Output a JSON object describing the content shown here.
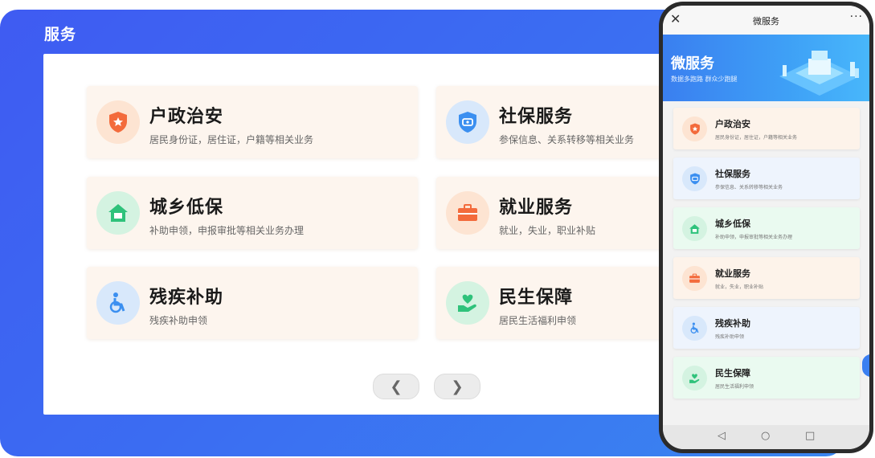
{
  "desktop": {
    "title": "服务",
    "cards": [
      {
        "title": "户政治安",
        "desc": "居民身份证，居住证，户籍等相关业务",
        "icon": "police-badge-icon",
        "color": "#f36b3c",
        "bg": "#fde4d2"
      },
      {
        "title": "社保服务",
        "desc": "参保信息、关系转移等相关业务",
        "icon": "social-security-icon",
        "color": "#3b8ff0",
        "bg": "#d8e8fb"
      },
      {
        "title": "城乡低保",
        "desc": "补助申领，申报审批等相关业务办理",
        "icon": "low-income-house-icon",
        "color": "#2fc27b",
        "bg": "#d4f3e1"
      },
      {
        "title": "就业服务",
        "desc": "就业，失业，职业补贴",
        "icon": "briefcase-icon",
        "color": "#f36b3c",
        "bg": "#fde4d2"
      },
      {
        "title": "残疾补助",
        "desc": "残疾补助申领",
        "icon": "wheelchair-icon",
        "color": "#3b8ff0",
        "bg": "#d8e8fb"
      },
      {
        "title": "民生保障",
        "desc": "居民生活福利申领",
        "icon": "heart-hand-icon",
        "color": "#2fc27b",
        "bg": "#d4f3e1"
      }
    ],
    "pager": {
      "prev": "❮",
      "next": "❯"
    }
  },
  "phone": {
    "close": "✕",
    "title": "微服务",
    "more": "···",
    "banner_title": "微服务",
    "banner_subtitle": "数据多跑路  群众少跑腿",
    "cards": [
      {
        "title": "户政治安",
        "desc": "居民身份证，居住证，户籍等相关业务",
        "bg": "#fdf3ea",
        "icon_bg": "#fde4d2",
        "color": "#f36b3c"
      },
      {
        "title": "社保服务",
        "desc": "参保信息、关系转移等相关业务",
        "bg": "#eef4fd",
        "icon_bg": "#d8e8fb",
        "color": "#3b8ff0"
      },
      {
        "title": "城乡低保",
        "desc": "补助申领，申报审批等相关业务办理",
        "bg": "#eafaf0",
        "icon_bg": "#d4f3e1",
        "color": "#2fc27b"
      },
      {
        "title": "就业服务",
        "desc": "就业，失业，职业补贴",
        "bg": "#fdf3ea",
        "icon_bg": "#fde4d2",
        "color": "#f36b3c"
      },
      {
        "title": "残疾补助",
        "desc": "残疾补助申领",
        "bg": "#eef4fd",
        "icon_bg": "#d8e8fb",
        "color": "#3b8ff0"
      },
      {
        "title": "民生保障",
        "desc": "居民生活福利申领",
        "bg": "#eafaf0",
        "icon_bg": "#d4f3e1",
        "color": "#2fc27b"
      }
    ],
    "nav": {
      "back": "◁",
      "home": "○",
      "recent": "□"
    }
  }
}
